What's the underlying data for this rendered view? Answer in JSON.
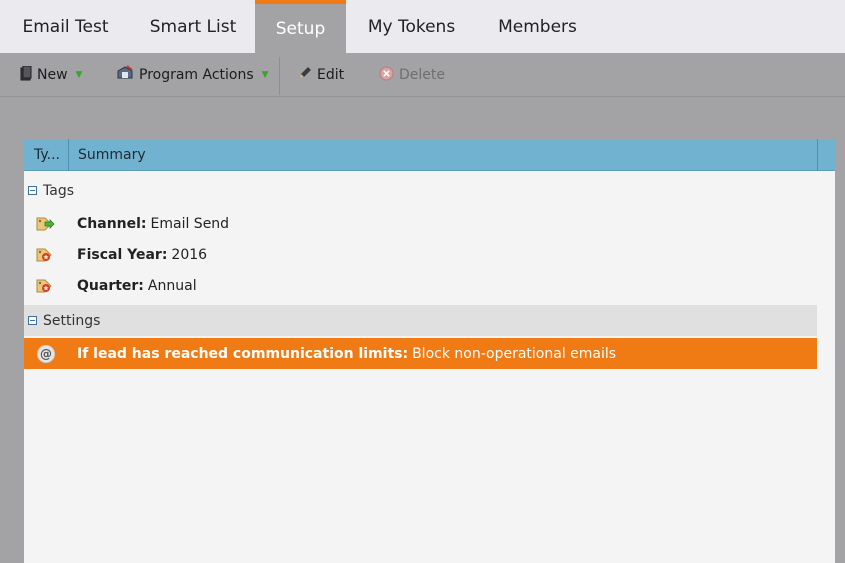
{
  "tabs": [
    {
      "label": "Email Test",
      "active": false
    },
    {
      "label": "Smart List",
      "active": false
    },
    {
      "label": "Setup",
      "active": true
    },
    {
      "label": "My Tokens",
      "active": false
    },
    {
      "label": "Members",
      "active": false
    }
  ],
  "toolbar": {
    "new_label": "New",
    "program_actions_label": "Program Actions",
    "edit_label": "Edit",
    "delete_label": "Delete"
  },
  "table": {
    "headers": [
      "Ty...",
      "Summary"
    ],
    "groups": [
      {
        "label": "Tags",
        "rows": [
          {
            "key": "Channel:",
            "value": "Email Send",
            "icon": "tag-arrow-icon"
          },
          {
            "key": "Fiscal Year:",
            "value": "2016",
            "icon": "tag-star-icon"
          },
          {
            "key": "Quarter:",
            "value": "Annual",
            "icon": "tag-star-icon"
          }
        ]
      },
      {
        "label": "Settings",
        "rows": [
          {
            "key": "If lead has reached communication limits:",
            "value": "Block non-operational emails",
            "icon": "at-icon",
            "selected": true
          }
        ]
      }
    ]
  },
  "colors": {
    "accent": "#f07b14",
    "header_blue": "#72b2d1",
    "toolbar_gray": "#a3a3a6"
  }
}
